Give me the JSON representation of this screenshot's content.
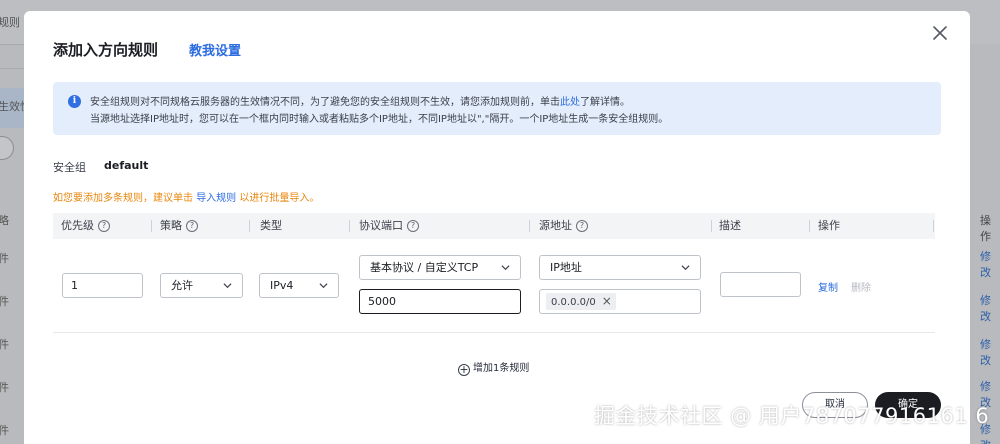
{
  "background": {
    "left_texts": [
      "规则",
      "生效性",
      "略",
      "件",
      "件",
      "件",
      "件",
      "件"
    ],
    "right_header": "操作",
    "right_links": [
      "修改",
      "修改",
      "修改",
      "修改",
      "修改"
    ]
  },
  "dialog": {
    "title": "添加入方向规则",
    "help_link": "教我设置",
    "notice": {
      "line1_prefix": "安全组规则对不同规格云服务器的生效情况不同，为了避免您的安全组规则不生效，请您添加规则前，单击",
      "line1_link": "此处",
      "line1_suffix": "了解详情。",
      "line2": "当源地址选择IP地址时，您可以在一个框内同时输入或者粘贴多个IP地址，不同IP地址以\",\"隔开。一个IP地址生成一条安全组规则。"
    },
    "security_group_label": "安全组",
    "security_group_value": "default",
    "bulk_hint": {
      "prefix": "如您要添加多条规则，建议单击",
      "link": "导入规则",
      "suffix": "以进行批量导入。"
    },
    "columns": [
      {
        "label": "优先级",
        "help": true
      },
      {
        "label": "策略",
        "help": true
      },
      {
        "label": "类型",
        "help": false
      },
      {
        "label": "协议端口",
        "help": true
      },
      {
        "label": "源地址",
        "help": true
      },
      {
        "label": "描述",
        "help": false
      },
      {
        "label": "操作",
        "help": false
      }
    ],
    "row": {
      "priority": "1",
      "policy": "允许",
      "type": "IPv4",
      "protocol": "基本协议 / 自定义TCP",
      "port": "5000",
      "source_type": "IP地址",
      "source_tag": "0.0.0.0/0",
      "description": "",
      "copy_label": "复制",
      "delete_label": "删除"
    },
    "add_rule_label": "增加1条规则",
    "cancel_label": "取消",
    "ok_label": "确定"
  },
  "watermark": "掘金技术社区 @ 用户787077916161 6"
}
